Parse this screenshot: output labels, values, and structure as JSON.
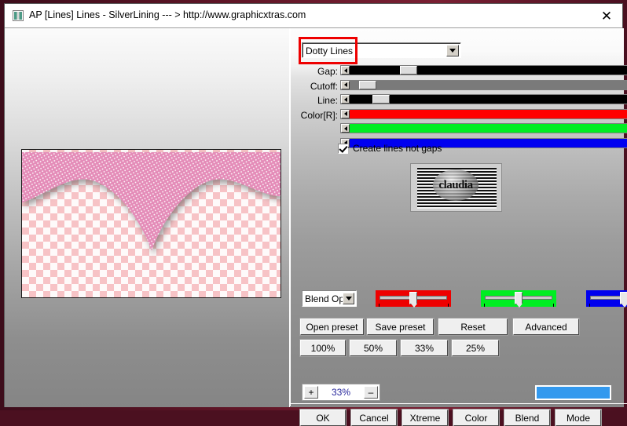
{
  "window": {
    "title": "AP [Lines]  Lines - SilverLining    --- > http://www.graphicxtras.com",
    "close_label": "✕",
    "icon": "app-icon"
  },
  "preset": {
    "value": "Dotty Lines",
    "dropdown_icon": "chevron-down-icon"
  },
  "sliders": [
    {
      "label": "Gap:",
      "value": "8",
      "fill": "#000000",
      "thumb_pct": 13,
      "fill_pct": 100
    },
    {
      "label": "Cutoff:",
      "value": "6",
      "fill": "#7a7a7a",
      "thumb_pct": 4,
      "fill_pct": 100
    },
    {
      "label": "Line:",
      "value": "10",
      "fill": "#000000",
      "thumb_pct": 7,
      "fill_pct": 100
    },
    {
      "label": "Color[R]:",
      "value": "255",
      "fill": "#ff0000",
      "thumb_pct": 96,
      "fill_pct": 96
    },
    {
      "label": "",
      "value": "255",
      "fill": "#00ee22",
      "thumb_pct": 96,
      "fill_pct": 96
    },
    {
      "label": "",
      "value": "255",
      "fill": "#0000f0",
      "thumb_pct": 96,
      "fill_pct": 96
    }
  ],
  "checkbox": {
    "label": "Create lines not gaps",
    "checked": true
  },
  "thumbnail": {
    "caption": "claudia"
  },
  "blend_option": {
    "value": "Blend Opti",
    "dropdown_icon": "chevron-down-icon"
  },
  "rgb_sliders": [
    {
      "name": "red",
      "color": "#ee0000",
      "knob_pct": 50
    },
    {
      "name": "green",
      "color": "#00ee22",
      "knob_pct": 50
    },
    {
      "name": "blue",
      "color": "#0000ee",
      "knob_pct": 50
    }
  ],
  "preset_buttons": [
    {
      "label": "Open preset"
    },
    {
      "label": "Save preset"
    },
    {
      "label": "Reset"
    },
    {
      "label": "Advanced"
    }
  ],
  "scale_buttons": [
    {
      "label": "100%"
    },
    {
      "label": "50%"
    },
    {
      "label": "33%"
    },
    {
      "label": "25%"
    }
  ],
  "zoom": {
    "plus_label": "+",
    "value": "33%",
    "minus_label": "–"
  },
  "color_swatch": {
    "color": "#3399ee"
  },
  "action_buttons": [
    {
      "label": "OK"
    },
    {
      "label": "Cancel"
    },
    {
      "label": "Xtreme"
    },
    {
      "label": "Color"
    },
    {
      "label": "Blend"
    },
    {
      "label": "Mode"
    }
  ],
  "annotations": [
    {
      "name": "preset-highlight",
      "color": "#ee0000"
    },
    {
      "name": "values-highlight",
      "color": "#ee0000"
    }
  ],
  "colors": {
    "frame": "#5e1526",
    "accent_red": "#ee0000",
    "swatch_blue": "#3399ee",
    "zoom_text": "#25259b"
  }
}
